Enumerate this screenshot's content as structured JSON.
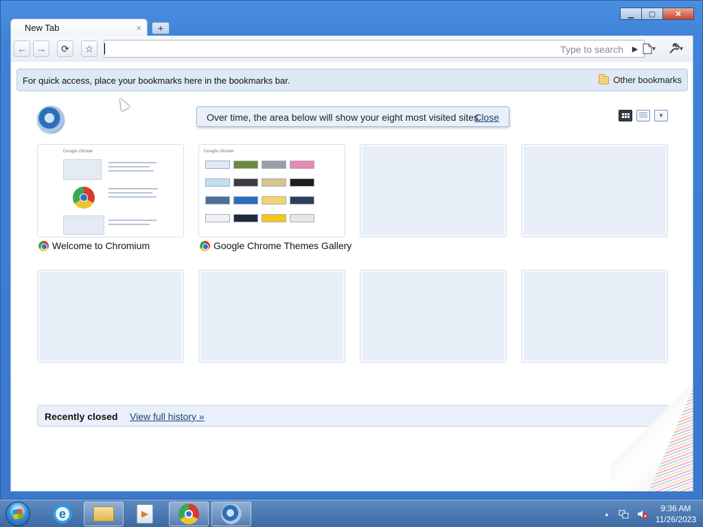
{
  "window": {
    "controls": {
      "minimize": "▁",
      "maximize": "▢",
      "close": "✕"
    }
  },
  "tabs": [
    {
      "label": "New Tab",
      "close": "×"
    }
  ],
  "new_tab_glyph": "+",
  "toolbar": {
    "back": "←",
    "forward": "→",
    "reload": "⟳",
    "star": "☆",
    "omnibox_value": "",
    "omnibox_placeholder": "Type to search",
    "go": "▶",
    "page_menu": "▾",
    "wrench_menu": "▾"
  },
  "bookmarks_bar": {
    "message": "For quick access, place your bookmarks here in the bookmarks bar.",
    "other_bookmarks": "Other bookmarks"
  },
  "notice": {
    "text": "Over time, the area below will show your eight most visited sites.",
    "close": "Close"
  },
  "most_visited": [
    {
      "title": "Welcome to Chromium",
      "kind": "welcome",
      "favicon": "chrome-icon"
    },
    {
      "title": "Google Chrome Themes Gallery",
      "kind": "themes",
      "favicon": "chrome-icon"
    },
    {
      "title": "",
      "kind": "empty"
    },
    {
      "title": "",
      "kind": "empty"
    },
    {
      "title": "",
      "kind": "empty"
    },
    {
      "title": "",
      "kind": "empty"
    },
    {
      "title": "",
      "kind": "empty"
    },
    {
      "title": "",
      "kind": "empty"
    }
  ],
  "recently_closed": {
    "title": "Recently closed",
    "link": "View full history »"
  },
  "taskbar": {
    "apps": [
      "internet-explorer-icon",
      "windows-explorer-icon",
      "media-player-icon",
      "chrome-icon",
      "chromium-icon"
    ],
    "time": "9:36 AM",
    "date": "11/26/2023",
    "tray_up": "▲"
  },
  "colors": {
    "accent": "#3f82d8",
    "link": "#1c3f77",
    "bookmarks_bar_bg": "#dfe8f5"
  }
}
